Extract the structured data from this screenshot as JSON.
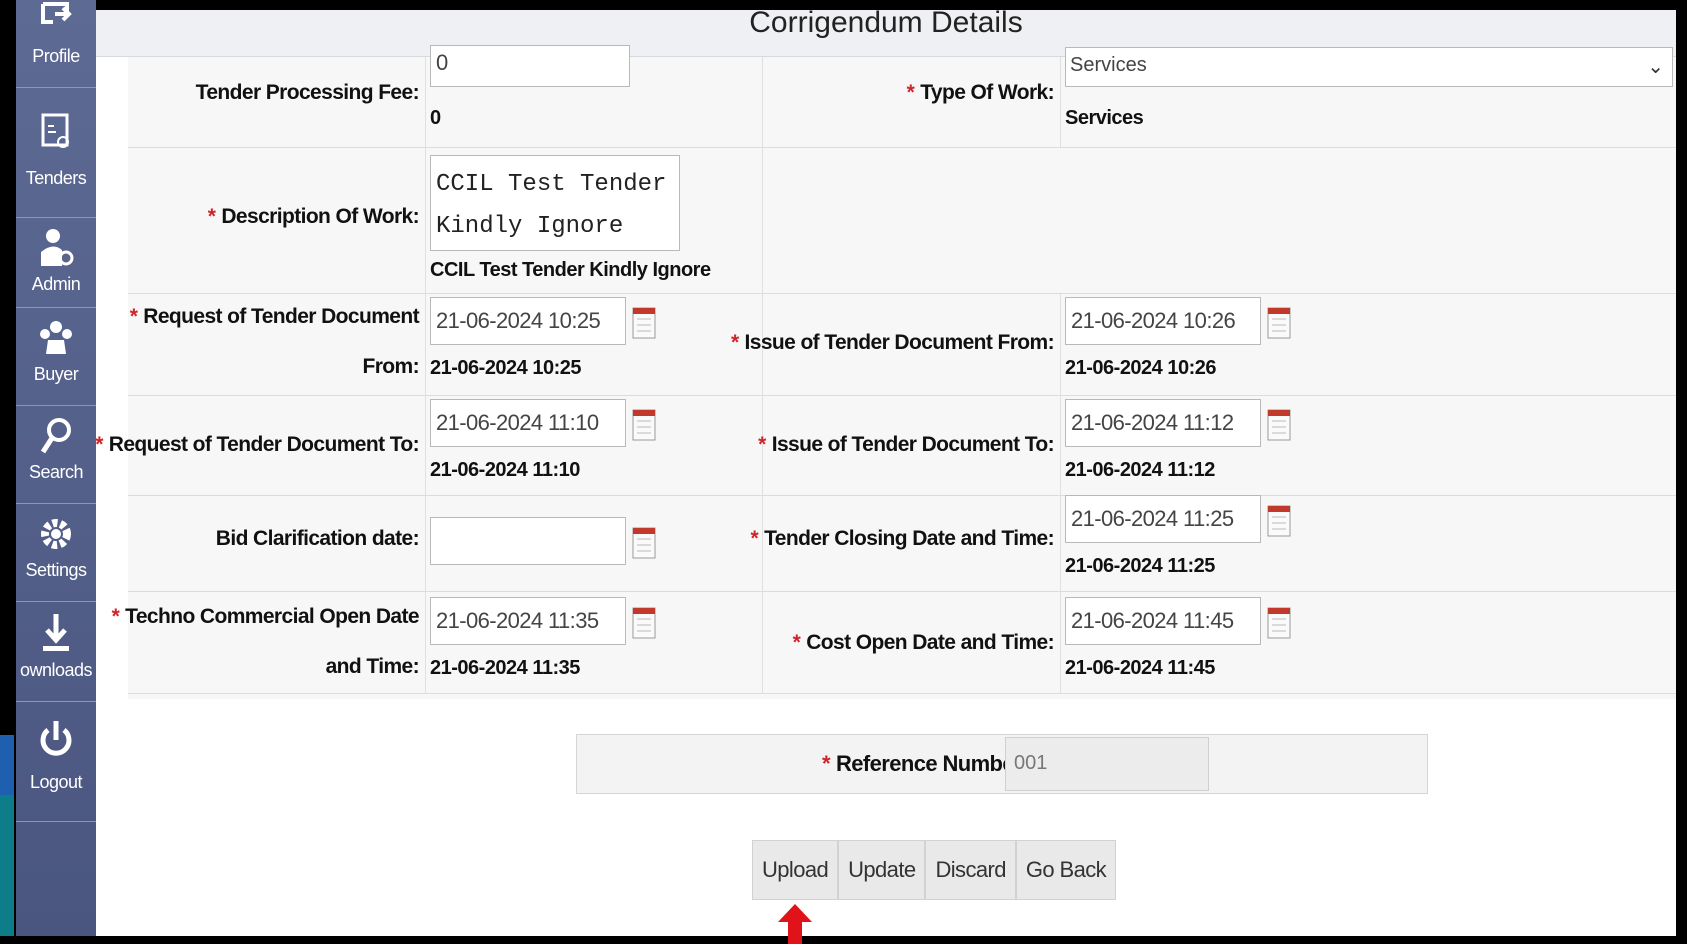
{
  "sidebar": {
    "items": [
      {
        "label": "Profile",
        "icon": "profile-icon"
      },
      {
        "label": "Tenders",
        "icon": "tenders-icon"
      },
      {
        "label": "Admin",
        "icon": "admin-icon"
      },
      {
        "label": "Buyer",
        "icon": "buyer-icon"
      },
      {
        "label": "Search",
        "icon": "search-icon"
      },
      {
        "label": "Settings",
        "icon": "gear-icon"
      },
      {
        "label": "ownloads",
        "icon": "download-icon"
      },
      {
        "label": "Logout",
        "icon": "power-icon"
      }
    ]
  },
  "page": {
    "title": "Corrigendum Details"
  },
  "form": {
    "processing_fee": {
      "label": "Tender Processing Fee:",
      "input": "0",
      "value": "0"
    },
    "type_of_work": {
      "label": "Type Of Work:",
      "input": "Services",
      "value": "Services"
    },
    "description": {
      "label": "Description Of Work:",
      "input": "CCIL Test Tender\nKindly Ignore",
      "value": "CCIL Test Tender Kindly Ignore"
    },
    "request_from": {
      "label_1": "Request of Tender Document",
      "label_2": "From:",
      "input": "21-06-2024 10:25",
      "value": "21-06-2024 10:25"
    },
    "issue_from": {
      "label": "Issue of Tender Document From:",
      "input": "21-06-2024 10:26",
      "value": "21-06-2024 10:26"
    },
    "request_to": {
      "label": "Request of Tender Document To:",
      "input": "21-06-2024 11:10",
      "value": "21-06-2024 11:10"
    },
    "issue_to": {
      "label": "Issue of Tender Document To:",
      "input": "21-06-2024 11:12",
      "value": "21-06-2024 11:12"
    },
    "bid_clarification": {
      "label": "Bid Clarification date:",
      "input": ""
    },
    "closing": {
      "label": "Tender Closing Date and Time:",
      "input": "21-06-2024 11:25",
      "value": "21-06-2024 11:25"
    },
    "techno_open": {
      "label_1": "Techno Commercial Open Date",
      "label_2": "and Time:",
      "input": "21-06-2024 11:35",
      "value": "21-06-2024 11:35"
    },
    "cost_open": {
      "label": "Cost Open Date and Time:",
      "input": "21-06-2024 11:45",
      "value": "21-06-2024 11:45"
    }
  },
  "reference": {
    "label": "Reference Number :",
    "value": "001"
  },
  "buttons": {
    "upload": "Upload",
    "update": "Update",
    "discard": "Discard",
    "go_back": "Go Back"
  },
  "colors": {
    "sidebar": "#56628c",
    "required": "#d0232a",
    "arrow": "#e0121a"
  }
}
